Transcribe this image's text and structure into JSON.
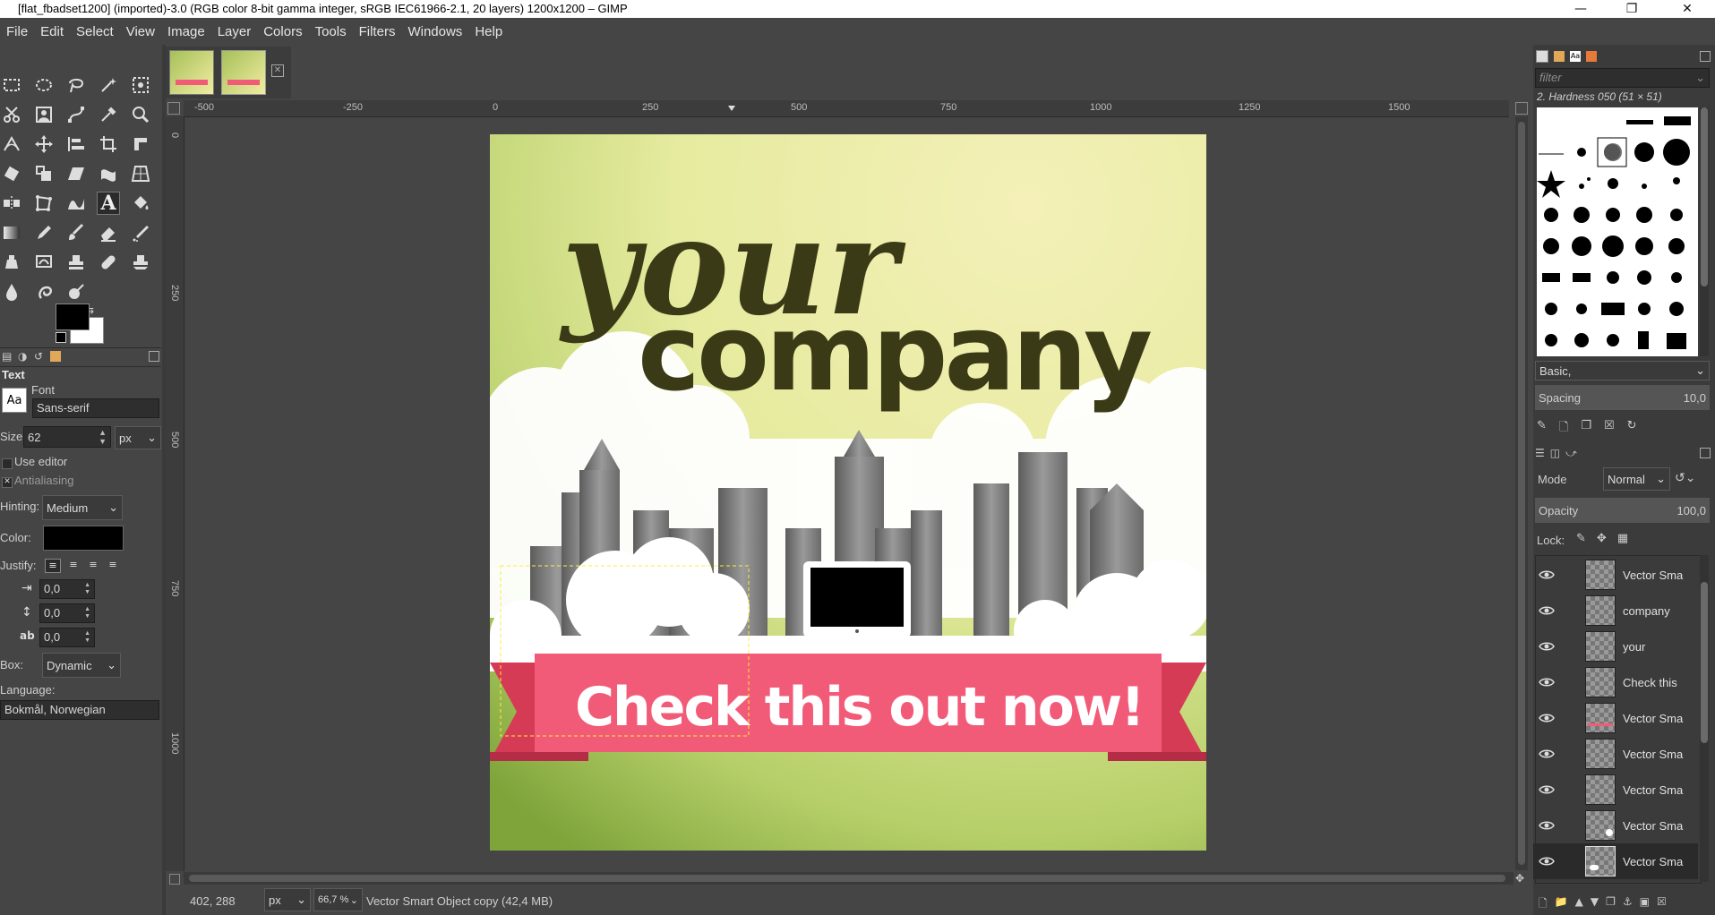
{
  "window": {
    "title": "[flat_fbadset1200] (imported)-3.0 (RGB color 8-bit gamma integer, sRGB IEC61966-2.1, 20 layers) 1200x1200 – GIMP"
  },
  "menu": [
    "File",
    "Edit",
    "Select",
    "View",
    "Image",
    "Layer",
    "Colors",
    "Tools",
    "Filters",
    "Windows",
    "Help"
  ],
  "toolbox": {
    "panel_title": "Text",
    "font_label": "Font",
    "font_value": "Sans-serif",
    "font_icon_text": "Aa",
    "size_label": "Size:",
    "size_value": "62",
    "size_unit": "px",
    "use_editor_label": "Use editor",
    "antialiasing_label": "Antialiasing",
    "hinting_label": "Hinting:",
    "hinting_value": "Medium",
    "color_label": "Color:",
    "justify_label": "Justify:",
    "indent_value": "0,0",
    "line_spacing_value": "0,0",
    "letter_spacing_value": "0,0",
    "box_label": "Box:",
    "box_value": "Dynamic",
    "language_label": "Language:",
    "language_value": "Bokmål, Norwegian"
  },
  "rulers": {
    "top": [
      "-500",
      "-250",
      "0",
      "250",
      "500",
      "750",
      "1000",
      "1250",
      "1500"
    ],
    "left": [
      "0",
      "250",
      "500",
      "750",
      "1000"
    ]
  },
  "canvas": {
    "text_your": "your",
    "text_company": "company",
    "banner_text": "Check this out now!"
  },
  "status": {
    "coords": "402, 288",
    "unit": "px",
    "zoom": "66,7 %",
    "message": "Vector Smart Object copy (42,4 MB)"
  },
  "dock": {
    "filter_placeholder": "filter",
    "brush_name": "2. Hardness 050 (51 × 51)",
    "preset": "Basic,",
    "spacing_label": "Spacing",
    "spacing_value": "10,0",
    "mode_label": "Mode",
    "mode_value": "Normal",
    "opacity_label": "Opacity",
    "opacity_value": "100,0",
    "lock_label": "Lock:",
    "layers": [
      "Vector Sma",
      "company",
      "your",
      "Check this",
      "Vector Sma",
      "Vector Sma",
      "Vector Sma",
      "Vector Sma",
      "Vector Sma"
    ]
  },
  "colors": {
    "bg": "#454545",
    "banner": "#f25b78",
    "banner_dark": "#d63b55",
    "text_dark": "#3a3a17"
  }
}
